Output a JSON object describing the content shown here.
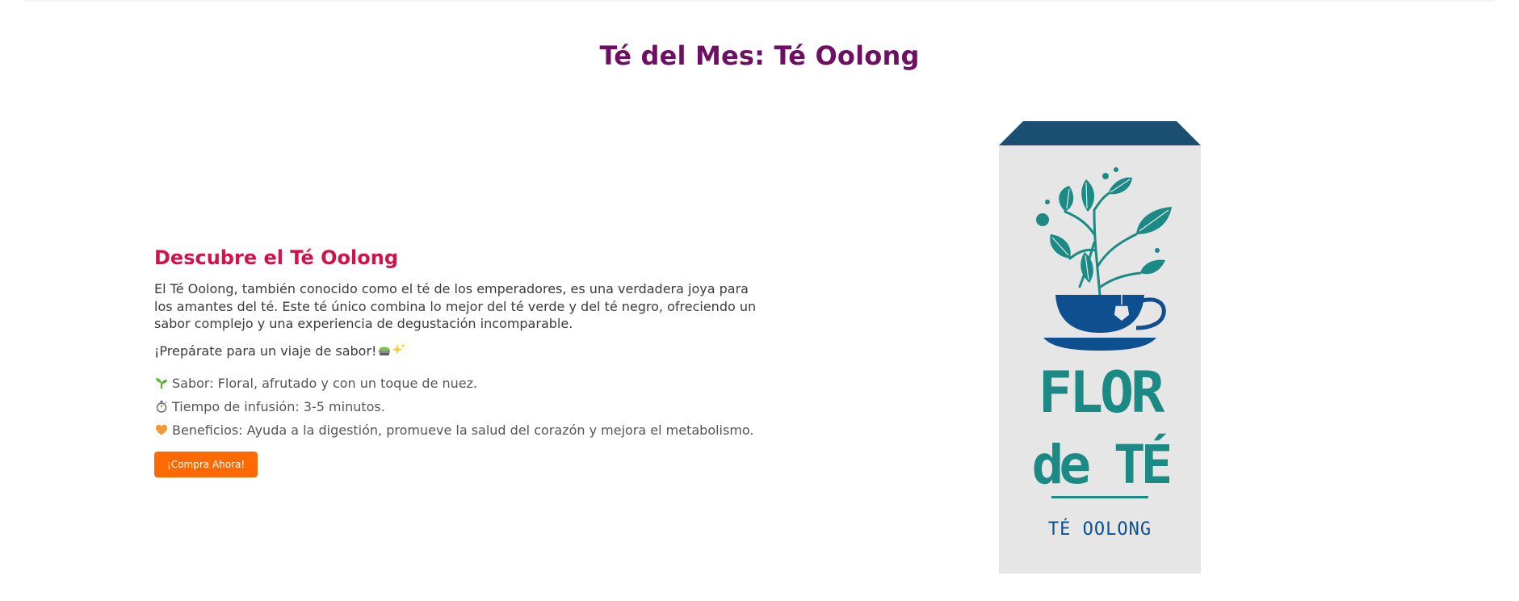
{
  "header": {
    "title": "Té del Mes: Té Oolong"
  },
  "intro": {
    "title": "Descubre el Té Oolong",
    "description": "El Té Oolong, también conocido como el té de los emperadores, es una verdadera joya para los amantes del té. Este té único combina lo mejor del té verde y del té negro, ofreciendo un sabor complejo y una experiencia de degustación incomparable.",
    "tagline": "¡Prepárate para un viaje de sabor!",
    "tagline_emoji": "🍵✨"
  },
  "features": [
    {
      "icon": "seedling-icon",
      "text": "Sabor: Floral, afrutado y con un toque de nuez."
    },
    {
      "icon": "stopwatch-icon",
      "text": "Tiempo de infusión: 3-5 minutos."
    },
    {
      "icon": "orange-heart-icon",
      "text": "Beneficios: Ayuda a la digestión, promueve la salud del corazón y mejora el metabolismo."
    }
  ],
  "cta": {
    "label": "¡Compra Ahora!"
  },
  "product": {
    "brand_line1": "FLOR",
    "brand_line2": "de TÉ",
    "variety": "TÉ OOLONG"
  },
  "colors": {
    "heading": "#6e0f63",
    "subheading": "#d3124a",
    "button": "#ff6a00",
    "pack_top": "#1b4f72",
    "pack_body": "#e6e6e6",
    "teal": "#1b8a84",
    "cup_blue": "#0e4f8f"
  }
}
